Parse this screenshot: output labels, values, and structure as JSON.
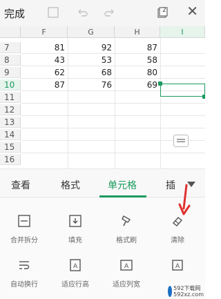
{
  "toolbar": {
    "done_label": "完成",
    "page_count": "2",
    "close_symbol": "✕"
  },
  "columns": [
    "F",
    "G",
    "H",
    "I"
  ],
  "rows": [
    "7",
    "8",
    "9",
    "10",
    "11",
    "12",
    "13",
    "14",
    "15",
    "16"
  ],
  "cells": [
    [
      "81",
      "92",
      "87"
    ],
    [
      "43",
      "53",
      "58"
    ],
    [
      "62",
      "68",
      "80"
    ],
    [
      "87",
      "76",
      "69"
    ]
  ],
  "tabs": [
    "查看",
    "格式",
    "单元格",
    "插"
  ],
  "active_tab": "单元格",
  "tools": [
    {
      "label": "合并拆分",
      "icon": "merge-split-icon"
    },
    {
      "label": "填充",
      "icon": "fill-icon"
    },
    {
      "label": "格式刷",
      "icon": "format-painter-icon"
    },
    {
      "label": "清除",
      "icon": "eraser-icon"
    },
    {
      "label": "自动换行",
      "icon": "wrap-text-icon"
    },
    {
      "label": "适应行高",
      "icon": "fit-row-height-icon"
    },
    {
      "label": "适应列宽",
      "icon": "fit-column-width-icon"
    },
    {
      "label": "",
      "icon": "more-tool-icon"
    }
  ],
  "watermark": {
    "line1": "592下载网",
    "line2": "592xz.com"
  },
  "colors": {
    "accent": "#1a9a5e",
    "annotation": "#e0312f"
  }
}
